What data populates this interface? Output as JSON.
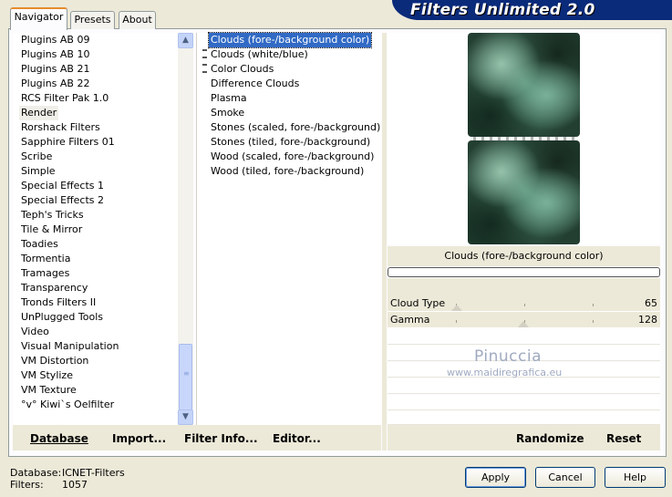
{
  "app": {
    "title": "Filters Unlimited 2.0"
  },
  "tabs": [
    {
      "label": "Navigator"
    },
    {
      "label": "Presets"
    },
    {
      "label": "About"
    }
  ],
  "categories": {
    "items": [
      "Plugins AB 09",
      "Plugins AB 10",
      "Plugins AB 21",
      "Plugins AB 22",
      "RCS Filter Pak 1.0",
      "Render",
      "Rorshack Filters",
      "Sapphire Filters 01",
      "Scribe",
      "Simple",
      "Special Effects 1",
      "Special Effects 2",
      "Teph's Tricks",
      "Tile & Mirror",
      "Toadies",
      "Tormentia",
      "Tramages",
      "Transparency",
      "Tronds Filters II",
      "UnPlugged Tools",
      "Video",
      "Visual Manipulation",
      "VM Distortion",
      "VM Stylize",
      "VM Texture",
      "°v° Kiwi`s Oelfilter"
    ],
    "selected_index": 5
  },
  "scrollbar": {
    "up_icon": "chevron-up-icon",
    "down_icon": "chevron-down-icon",
    "position_fraction": 0.92
  },
  "filters": {
    "items": [
      "Clouds (fore-/background color)",
      "Clouds (white/blue)",
      "Color Clouds",
      "Difference Clouds",
      "Plasma",
      "Smoke",
      "Stones (scaled, fore-/background)",
      "Stones (tiled, fore-/background)",
      "Wood (scaled, fore-/background)",
      "Wood (tiled, fore-/background)"
    ],
    "selected_index": 0
  },
  "left_toolbar": {
    "database": "Database",
    "import": "Import...",
    "filter_info": "Filter Info...",
    "editor": "Editor..."
  },
  "preview": {
    "filter_name": "Clouds (fore-/background color)",
    "progress": 0.0,
    "watermark_name": "Pinuccia",
    "watermark_url": "www.maidiregrafica.eu"
  },
  "params": [
    {
      "label": "Cloud Type",
      "value": "65"
    },
    {
      "label": "Gamma",
      "value": "128"
    }
  ],
  "right_toolbar": {
    "randomize": "Randomize",
    "reset": "Reset"
  },
  "status": {
    "database_label": "Database:",
    "database_value": "ICNET-Filters",
    "filters_label": "Filters:",
    "filters_value": "1057"
  },
  "buttons": {
    "apply": "Apply",
    "cancel": "Cancel",
    "help": "Help"
  },
  "colors": {
    "banner": "#0a2a7a",
    "selection": "#316ac5",
    "tab_accent": "#e68b2c",
    "cloud_green": "#4f8a70"
  }
}
